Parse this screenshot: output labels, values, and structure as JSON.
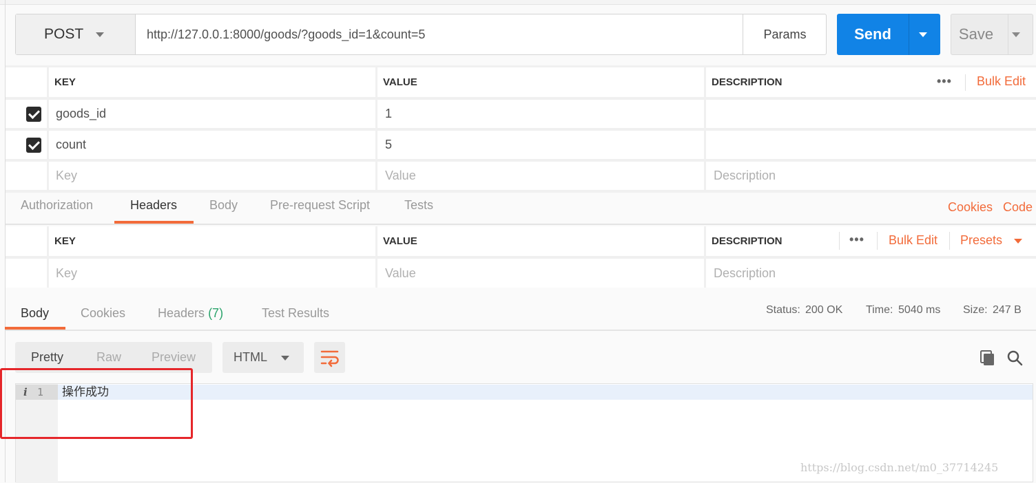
{
  "request": {
    "method": "POST",
    "url": "http://127.0.0.1:8000/goods/?goods_id=1&count=5",
    "params_label": "Params",
    "send_label": "Send",
    "save_label": "Save"
  },
  "params_table": {
    "headers": {
      "key": "KEY",
      "value": "VALUE",
      "description": "DESCRIPTION"
    },
    "bulk_edit": "Bulk Edit",
    "rows": [
      {
        "key": "goods_id",
        "value": "1",
        "checked": true
      },
      {
        "key": "count",
        "value": "5",
        "checked": true
      }
    ],
    "placeholders": {
      "key": "Key",
      "value": "Value",
      "description": "Description"
    }
  },
  "request_tabs": [
    "Authorization",
    "Headers",
    "Body",
    "Pre-request Script",
    "Tests"
  ],
  "active_request_tab": "Headers",
  "request_links": {
    "cookies": "Cookies",
    "code": "Code"
  },
  "headers_table": {
    "headers": {
      "key": "KEY",
      "value": "VALUE",
      "description": "DESCRIPTION"
    },
    "bulk_edit": "Bulk Edit",
    "presets": "Presets",
    "placeholders": {
      "key": "Key",
      "value": "Value",
      "description": "Description"
    }
  },
  "response_tabs": {
    "body": "Body",
    "cookies": "Cookies",
    "headers": "Headers",
    "headers_count": "(7)",
    "test_results": "Test Results"
  },
  "status": {
    "status_label": "Status:",
    "status_value": "200 OK",
    "time_label": "Time:",
    "time_value": "5040 ms",
    "size_label": "Size:",
    "size_value": "247 B"
  },
  "view_modes": [
    "Pretty",
    "Raw",
    "Preview"
  ],
  "format": "HTML",
  "editor": {
    "line_number": "1",
    "content": "操作成功"
  },
  "watermark": "https://blog.csdn.net/m0_37714245",
  "colors": {
    "accent": "#f26b3a",
    "send": "#1183e6",
    "status_ok": "#2aa36b",
    "highlight": "#e5262a"
  },
  "icons": [
    "chevron-down-icon",
    "checkbox-icon",
    "more-dots-icon",
    "wrap-lines-icon",
    "copy-icon",
    "search-icon",
    "info-icon"
  ]
}
